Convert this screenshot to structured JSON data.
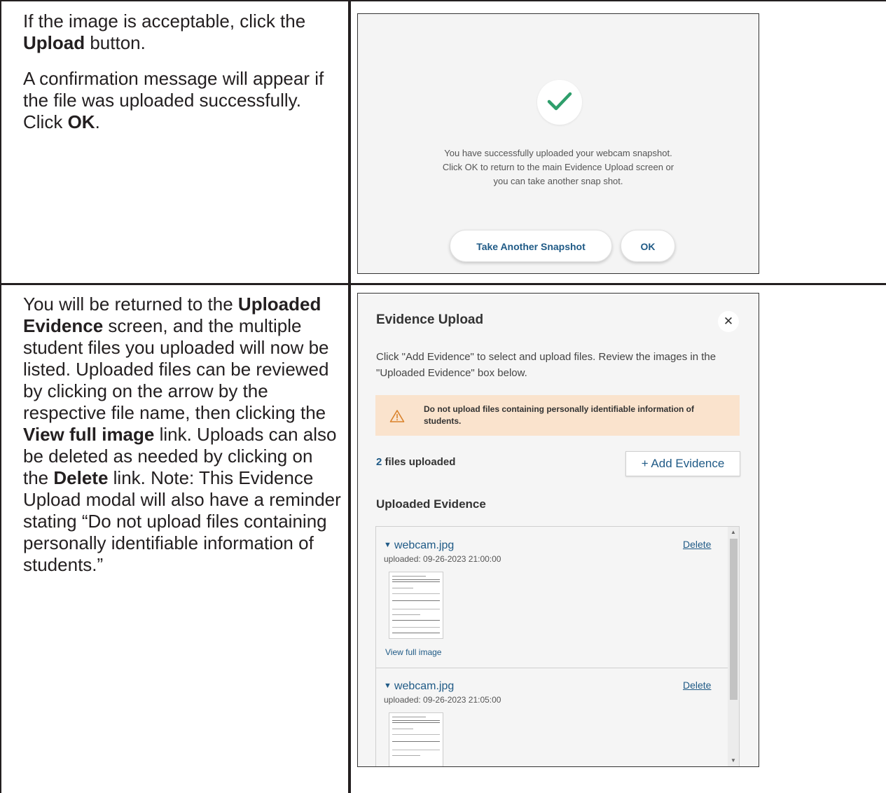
{
  "row1": {
    "instructions": [
      [
        {
          "text": "If the image is acceptable, click the ",
          "bold": false
        },
        {
          "text": "Upload",
          "bold": true
        },
        {
          "text": " button.",
          "bold": false
        }
      ],
      [
        {
          "text": "A confirmation message will appear if the file was uploaded successfully. Click ",
          "bold": false
        },
        {
          "text": "OK",
          "bold": true
        },
        {
          "text": ".",
          "bold": false
        }
      ]
    ],
    "confirmation": {
      "message_lines": [
        "You have successfully uploaded your webcam snapshot.",
        "Click OK to return to the main Evidence Upload screen or",
        "you can take another snap shot."
      ],
      "take_another_label": "Take Another Snapshot",
      "ok_label": "OK",
      "check_icon": "check-icon",
      "accent_color": "#2e9e6b"
    }
  },
  "row2": {
    "instructions": [
      [
        {
          "text": "You will be returned to the ",
          "bold": false
        },
        {
          "text": "Uploaded Evidence",
          "bold": true
        },
        {
          "text": " screen, and the multiple student files you uploaded will now be listed. Uploaded files can be reviewed by clicking on the arrow by the respective file name, then clicking the ",
          "bold": false
        },
        {
          "text": "View full image",
          "bold": true
        },
        {
          "text": " link. Uploads can also be deleted as needed by clicking on the ",
          "bold": false
        },
        {
          "text": "Delete",
          "bold": true
        },
        {
          "text": " link. Note: This Evidence Upload modal will also have a reminder stating “Do not upload files containing personally identifiable information of students.”",
          "bold": false
        }
      ]
    ],
    "modal": {
      "title": "Evidence Upload",
      "close_icon": "close-icon",
      "intro": "Click \"Add Evidence\" to select and upload files. Review the images in the \"Uploaded Evidence\" box below.",
      "warning_icon": "warning-triangle-icon",
      "warning": "Do not upload files containing personally identifiable information of students.",
      "files_count": "2",
      "files_label": " files uploaded",
      "add_button": "+ Add Evidence",
      "section_title": "Uploaded Evidence",
      "items": [
        {
          "name": "webcam.jpg",
          "date": "uploaded: 09-26-2023 21:00:00",
          "delete": "Delete",
          "view": "View full image"
        },
        {
          "name": "webcam.jpg",
          "date": "uploaded: 09-26-2023 21:05:00",
          "delete": "Delete",
          "view": ""
        }
      ],
      "link_color": "#1f5a86",
      "warning_bg": "#fae3cd"
    }
  }
}
